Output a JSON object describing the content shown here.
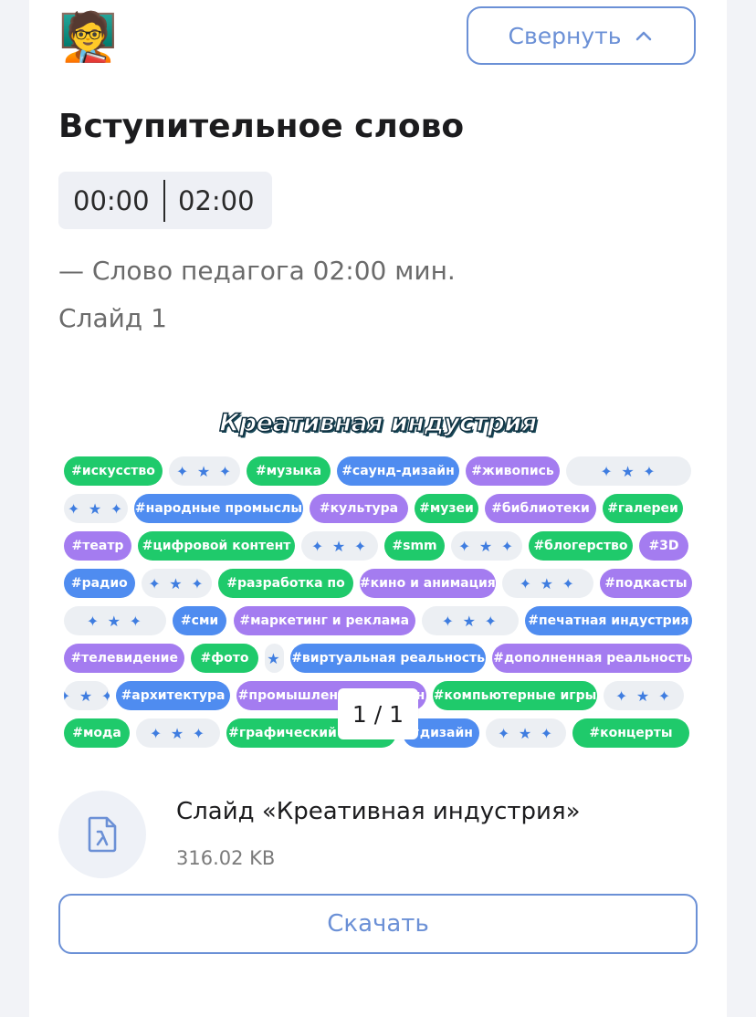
{
  "header": {
    "avatar_emoji": "🧑‍🏫",
    "collapse_label": "Свернуть"
  },
  "section": {
    "title": "Вступительное слово",
    "time_start": "00:00",
    "time_end": "02:00",
    "note": "— Слово педагога 02:00 мин.",
    "slide_label": "Слайд 1"
  },
  "slide": {
    "heading": "Креативная индустрия",
    "rows": [
      [
        {
          "text": "#искусство",
          "c": "g"
        },
        {
          "text": "",
          "c": "d"
        },
        {
          "text": "#музыка",
          "c": "g"
        },
        {
          "text": "#саунд-дизайн",
          "c": "b"
        },
        {
          "text": "#живопись",
          "c": "p"
        },
        {
          "text": "",
          "c": "d"
        }
      ],
      [
        {
          "text": "",
          "c": "d"
        },
        {
          "text": "#народные промыслы",
          "c": "b"
        },
        {
          "text": "#культура",
          "c": "p"
        },
        {
          "text": "#музеи",
          "c": "g"
        },
        {
          "text": "#библиотеки",
          "c": "p"
        },
        {
          "text": "#галереи",
          "c": "g"
        }
      ],
      [
        {
          "text": "#театр",
          "c": "p"
        },
        {
          "text": "#цифровой контент",
          "c": "g"
        },
        {
          "text": "",
          "c": "d"
        },
        {
          "text": "#smm",
          "c": "g"
        },
        {
          "text": "",
          "c": "d"
        },
        {
          "text": "#блогерство",
          "c": "g"
        },
        {
          "text": "#3D",
          "c": "p"
        }
      ],
      [
        {
          "text": "#радио",
          "c": "b"
        },
        {
          "text": "",
          "c": "d"
        },
        {
          "text": "#разработка по",
          "c": "g"
        },
        {
          "text": "#кино и анимация",
          "c": "p"
        },
        {
          "text": "",
          "c": "d"
        },
        {
          "text": "#подкасты",
          "c": "p"
        }
      ],
      [
        {
          "text": "",
          "c": "d"
        },
        {
          "text": "#сми",
          "c": "b"
        },
        {
          "text": "#маркетинг и реклама",
          "c": "p"
        },
        {
          "text": "",
          "c": "d"
        },
        {
          "text": "#печатная индустрия",
          "c": "b"
        }
      ],
      [
        {
          "text": "#телевидение",
          "c": "p"
        },
        {
          "text": "#фото",
          "c": "g"
        },
        {
          "text": "",
          "c": "d"
        },
        {
          "text": "#виртуальная реальность",
          "c": "b"
        },
        {
          "text": "#дополненная реальность",
          "c": "p"
        }
      ],
      [
        {
          "text": "",
          "c": "d"
        },
        {
          "text": "#архитектура",
          "c": "b"
        },
        {
          "text": "#промышленный дизайн",
          "c": "p"
        },
        {
          "text": "#компьютерные игры",
          "c": "g"
        },
        {
          "text": "",
          "c": "d"
        }
      ],
      [
        {
          "text": "#мода",
          "c": "g"
        },
        {
          "text": "",
          "c": "d"
        },
        {
          "text": "#графический дизайн",
          "c": "g"
        },
        {
          "text": "#дизайн",
          "c": "b"
        },
        {
          "text": "",
          "c": "d"
        },
        {
          "text": "#концерты",
          "c": "g"
        }
      ]
    ],
    "pager": "1 / 1"
  },
  "file": {
    "name": "Слайд «Креативная индустрия»",
    "size": "316.02 KB",
    "download_label": "Скачать"
  },
  "colors": {
    "accent": "#6b90d6",
    "green": "#1fca6b",
    "blue": "#4f8cf0",
    "purple": "#a47cf0"
  }
}
